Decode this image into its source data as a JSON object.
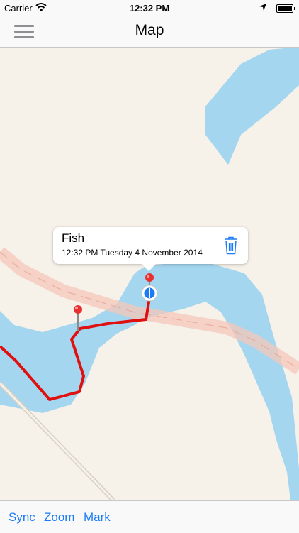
{
  "status_bar": {
    "carrier": "Carrier",
    "time": "12:32 PM"
  },
  "nav": {
    "title": "Map"
  },
  "callout": {
    "title": "Fish",
    "subtitle": "12:32 PM Tuesday 4 November 2014"
  },
  "toolbar": {
    "sync": "Sync",
    "zoom": "Zoom",
    "mark": "Mark"
  },
  "colors": {
    "water": "#a5d6f0",
    "land": "#f6f1e9",
    "track": "#e01010",
    "road": "#f6c7b9",
    "accent": "#1b7cf5",
    "pin": "#e83030"
  },
  "icons": [
    "wifi-icon",
    "location-arrow-icon",
    "battery-icon",
    "menu-icon",
    "trash-icon",
    "map-pin-icon",
    "current-location-icon"
  ]
}
